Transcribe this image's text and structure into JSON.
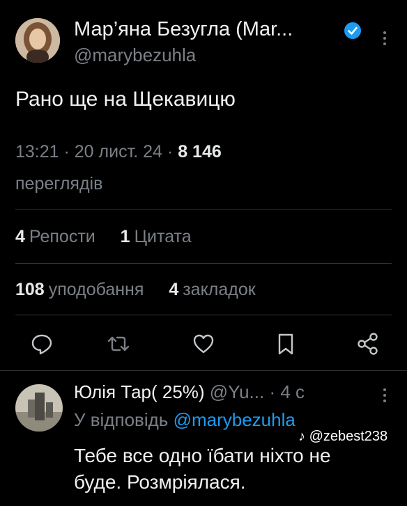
{
  "tweet": {
    "author_name": "Мар’яна Безугла (Мar...",
    "author_handle": "@marybezuhla",
    "text": "Рано ще на Щекавицю",
    "timestamp": "13:21 · 20 лист. 24 ·",
    "views_count": "8 146",
    "views_label": "переглядів",
    "reposts_count": "4",
    "reposts_label": "Репости",
    "quotes_count": "1",
    "quotes_label": "Цитата",
    "likes_count": "108",
    "likes_label": "уподобання",
    "bookmarks_count": "4",
    "bookmarks_label": "закладок",
    "verified_color": "#1d9bf0"
  },
  "actions": [
    "reply-icon",
    "repost-icon",
    "like-icon",
    "bookmark-icon",
    "share-icon"
  ],
  "reply": {
    "author_name": "Юлія Тар( 25%)",
    "author_handle": "@Yu...",
    "time": "· 4 с",
    "replying_prefix": "У відповідь",
    "replying_handle": "@marybezuhla",
    "text_line1": "Тебе все одно їбати ніхто не",
    "text_line2": "буде. Розмріялася."
  },
  "watermark": "@zebest238"
}
